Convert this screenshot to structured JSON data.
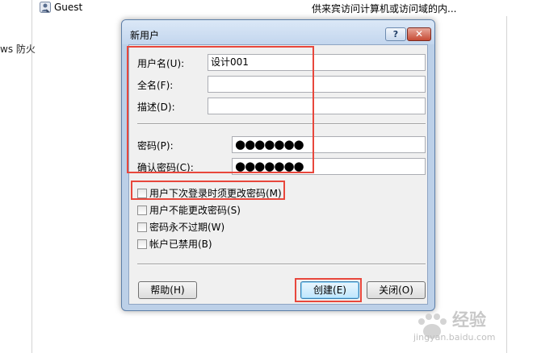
{
  "background": {
    "side_text": "ws 防火",
    "user_row": {
      "name": "Guest",
      "description": "供来宾访问计算机或访问域的内..."
    }
  },
  "dialog": {
    "title": "新用户",
    "help_label": "?",
    "close_label": "✕",
    "fields": {
      "username": {
        "label": "用户名(U):",
        "value": "设计001"
      },
      "fullname": {
        "label": "全名(F):",
        "value": ""
      },
      "description": {
        "label": "描述(D):",
        "value": ""
      },
      "password": {
        "label": "密码(P):",
        "value": "●●●●●●●"
      },
      "confirm_password": {
        "label": "确认密码(C):",
        "value": "●●●●●●●"
      }
    },
    "checkboxes": [
      {
        "label": "用户下次登录时须更改密码(M)",
        "checked": false
      },
      {
        "label": "用户不能更改密码(S)",
        "checked": false
      },
      {
        "label": "密码永不过期(W)",
        "checked": false
      },
      {
        "label": "帐户已禁用(B)",
        "checked": false
      }
    ],
    "buttons": {
      "help": "帮助(H)",
      "create": "创建(E)",
      "close": "关闭(O)"
    }
  },
  "watermark": {
    "text": "经验",
    "url": "jingyan.baidu.com"
  },
  "colors": {
    "highlight": "#e8473c",
    "dialog_frame": "#bcd0e8",
    "client": "#f0f0f0"
  }
}
